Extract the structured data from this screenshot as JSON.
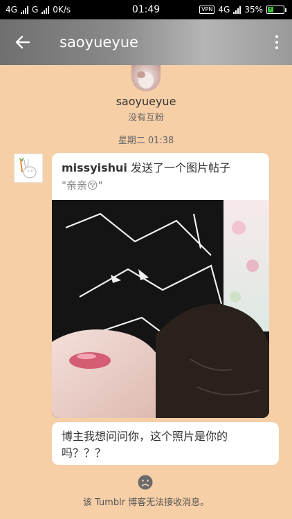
{
  "status_bar": {
    "network_1": "4G",
    "network_2": "G",
    "speed": "0K/s",
    "time": "01:49",
    "vpn": "VPN",
    "network_3": "4G",
    "battery_percent": "35%",
    "battery_level": 0.35
  },
  "header": {
    "title": "saoyueyue"
  },
  "profile": {
    "name": "saoyueyue",
    "subtitle": "没有互粉"
  },
  "conversation": {
    "timestamp": "星期二 01:38",
    "post": {
      "author": "missyishui",
      "action_text": " 发送了一个图片帖子",
      "caption": "\"亲亲😚\""
    },
    "reply": {
      "text": "博主我想问问你，这个照片是你的吗？？？"
    }
  },
  "footer": {
    "notice": "该 Tumblr 博客无法接收消息。"
  },
  "icons": {
    "back": "back-arrow-icon",
    "menu": "more-vertical-icon",
    "footer": "sad-face-icon"
  },
  "colors": {
    "background": "#f6cfa7",
    "bubble": "#ffffff"
  }
}
